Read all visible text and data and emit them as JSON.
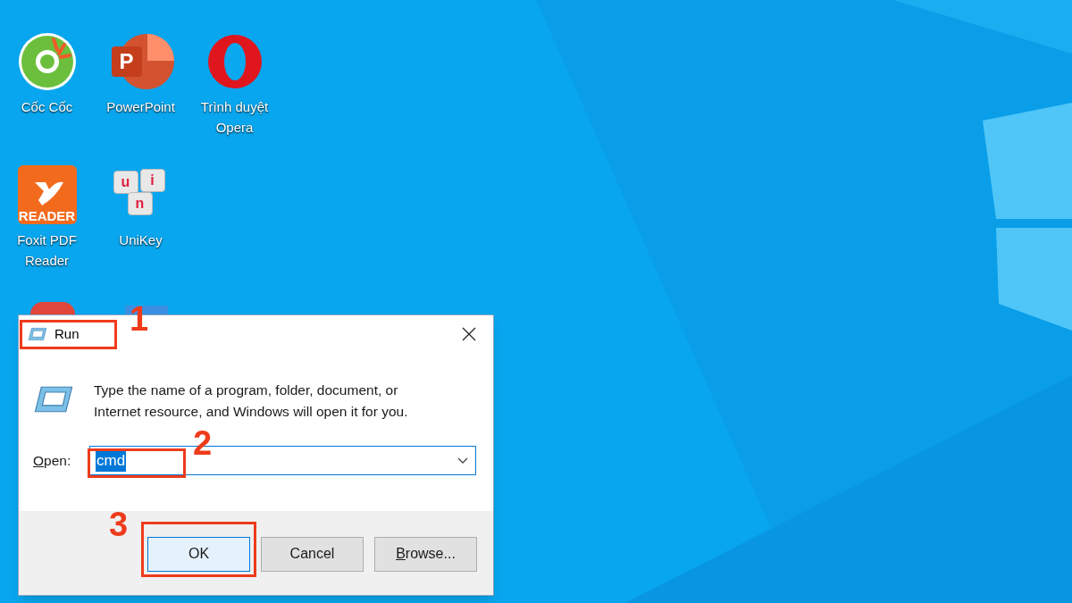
{
  "desktop_icons": [
    {
      "kind": "coccoc",
      "label": "Cốc Cốc"
    },
    {
      "kind": "powerpoint",
      "label": "PowerPoint",
      "logo_text": "P"
    },
    {
      "kind": "opera",
      "label": "Trình duyệt Opera"
    },
    {
      "kind": "foxit",
      "label": "Foxit PDF Reader",
      "logo_text": "READER"
    },
    {
      "kind": "unikey",
      "label": "UniKey",
      "key_letters": [
        "u",
        "i",
        "n"
      ]
    },
    {
      "kind": "hidden-red"
    },
    {
      "kind": "hidden-blue"
    }
  ],
  "dialog": {
    "title": "Run",
    "description": "Type the name of a program, folder, document, or Internet resource, and Windows will open it for you.",
    "open_label": {
      "text": "Open:",
      "access_key": true
    },
    "command": {
      "value": "cmd",
      "selected_text": true
    },
    "buttons": [
      {
        "label": "OK",
        "default": true,
        "access_key": false
      },
      {
        "label": "Cancel",
        "default": false,
        "access_key": false
      },
      {
        "label": "Browse...",
        "default": false,
        "access_key": true
      }
    ]
  },
  "annotations": [
    {
      "number": "1"
    },
    {
      "number": "2"
    },
    {
      "number": "3"
    }
  ]
}
